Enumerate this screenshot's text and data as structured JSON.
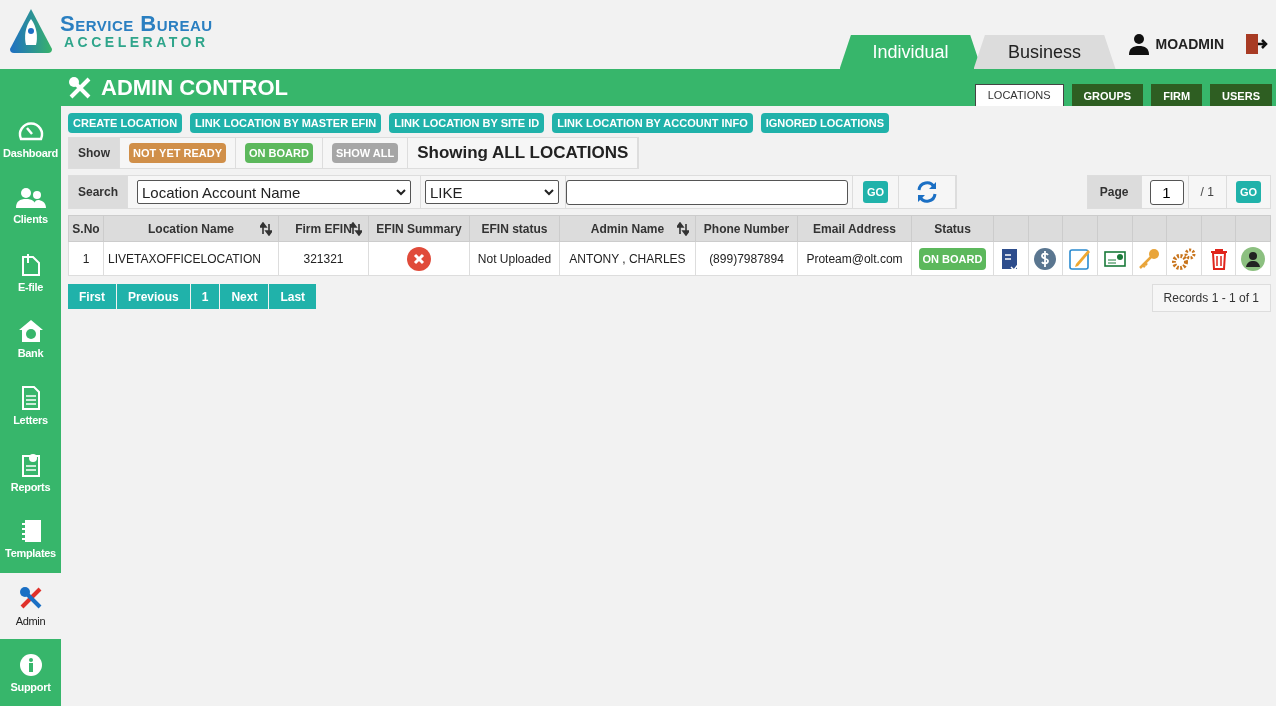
{
  "logo": {
    "line1": "Service Bureau",
    "line2": "ACCELERATOR"
  },
  "mode_tabs": [
    {
      "label": "Individual",
      "selected": true
    },
    {
      "label": "Business",
      "selected": false
    }
  ],
  "user": {
    "name": "MOADMIN"
  },
  "sidebar": {
    "items": [
      {
        "label": "Dashboard",
        "selected": false
      },
      {
        "label": "Clients",
        "selected": false
      },
      {
        "label": "E-file",
        "selected": false
      },
      {
        "label": "Bank",
        "selected": false
      },
      {
        "label": "Letters",
        "selected": false
      },
      {
        "label": "Reports",
        "selected": false
      },
      {
        "label": "Templates",
        "selected": false
      },
      {
        "label": "Admin",
        "selected": true
      },
      {
        "label": "Support",
        "selected": false
      }
    ]
  },
  "page_title": "ADMIN CONTROL",
  "sub_tabs": [
    {
      "label": "LOCATIONS",
      "selected": true
    },
    {
      "label": "GROUPS",
      "selected": false
    },
    {
      "label": "FIRM",
      "selected": false
    },
    {
      "label": "USERS",
      "selected": false
    }
  ],
  "action_buttons": [
    "CREATE LOCATION",
    "LINK LOCATION BY MASTER EFIN",
    "LINK LOCATION BY SITE ID",
    "LINK LOCATION BY ACCOUNT INFO",
    "IGNORED LOCATIONS"
  ],
  "filter": {
    "label": "Show",
    "buttons": [
      {
        "label": "NOT YET READY",
        "color": "#d08f49"
      },
      {
        "label": "ON BOARD",
        "color": "#5cb85c"
      },
      {
        "label": "SHOW ALL",
        "color": "#a6a6a6"
      }
    ],
    "heading": "Showing ALL LOCATIONS"
  },
  "search": {
    "label": "Search",
    "field": "Location Account Name",
    "operator": "LIKE",
    "go": "GO",
    "page_label": "Page",
    "page_value": "1",
    "page_total": "/ 1",
    "page_go": "GO"
  },
  "table": {
    "columns": [
      {
        "label": "S.No",
        "sortable": false
      },
      {
        "label": "Location Name",
        "sortable": true
      },
      {
        "label": "Firm EFIN",
        "sortable": true
      },
      {
        "label": "EFIN Summary",
        "sortable": false
      },
      {
        "label": "EFIN status",
        "sortable": false
      },
      {
        "label": "Admin Name",
        "sortable": true
      },
      {
        "label": "Phone Number",
        "sortable": false
      },
      {
        "label": "Email Address",
        "sortable": false
      },
      {
        "label": "Status",
        "sortable": false
      }
    ],
    "rows": [
      {
        "sno": "1",
        "location": "LIVETAXOFFICELOCATION",
        "efin": "321321",
        "efin_ok": false,
        "efin_status": "Not Uploaded",
        "admin": "ANTONY , CHARLES",
        "phone": "(899)7987894",
        "email": "Proteam@olt.com",
        "status": "ON BOARD"
      }
    ]
  },
  "pagination": [
    "First",
    "Previous",
    "1",
    "Next",
    "Last"
  ],
  "records": "Records 1 - 1 of 1"
}
